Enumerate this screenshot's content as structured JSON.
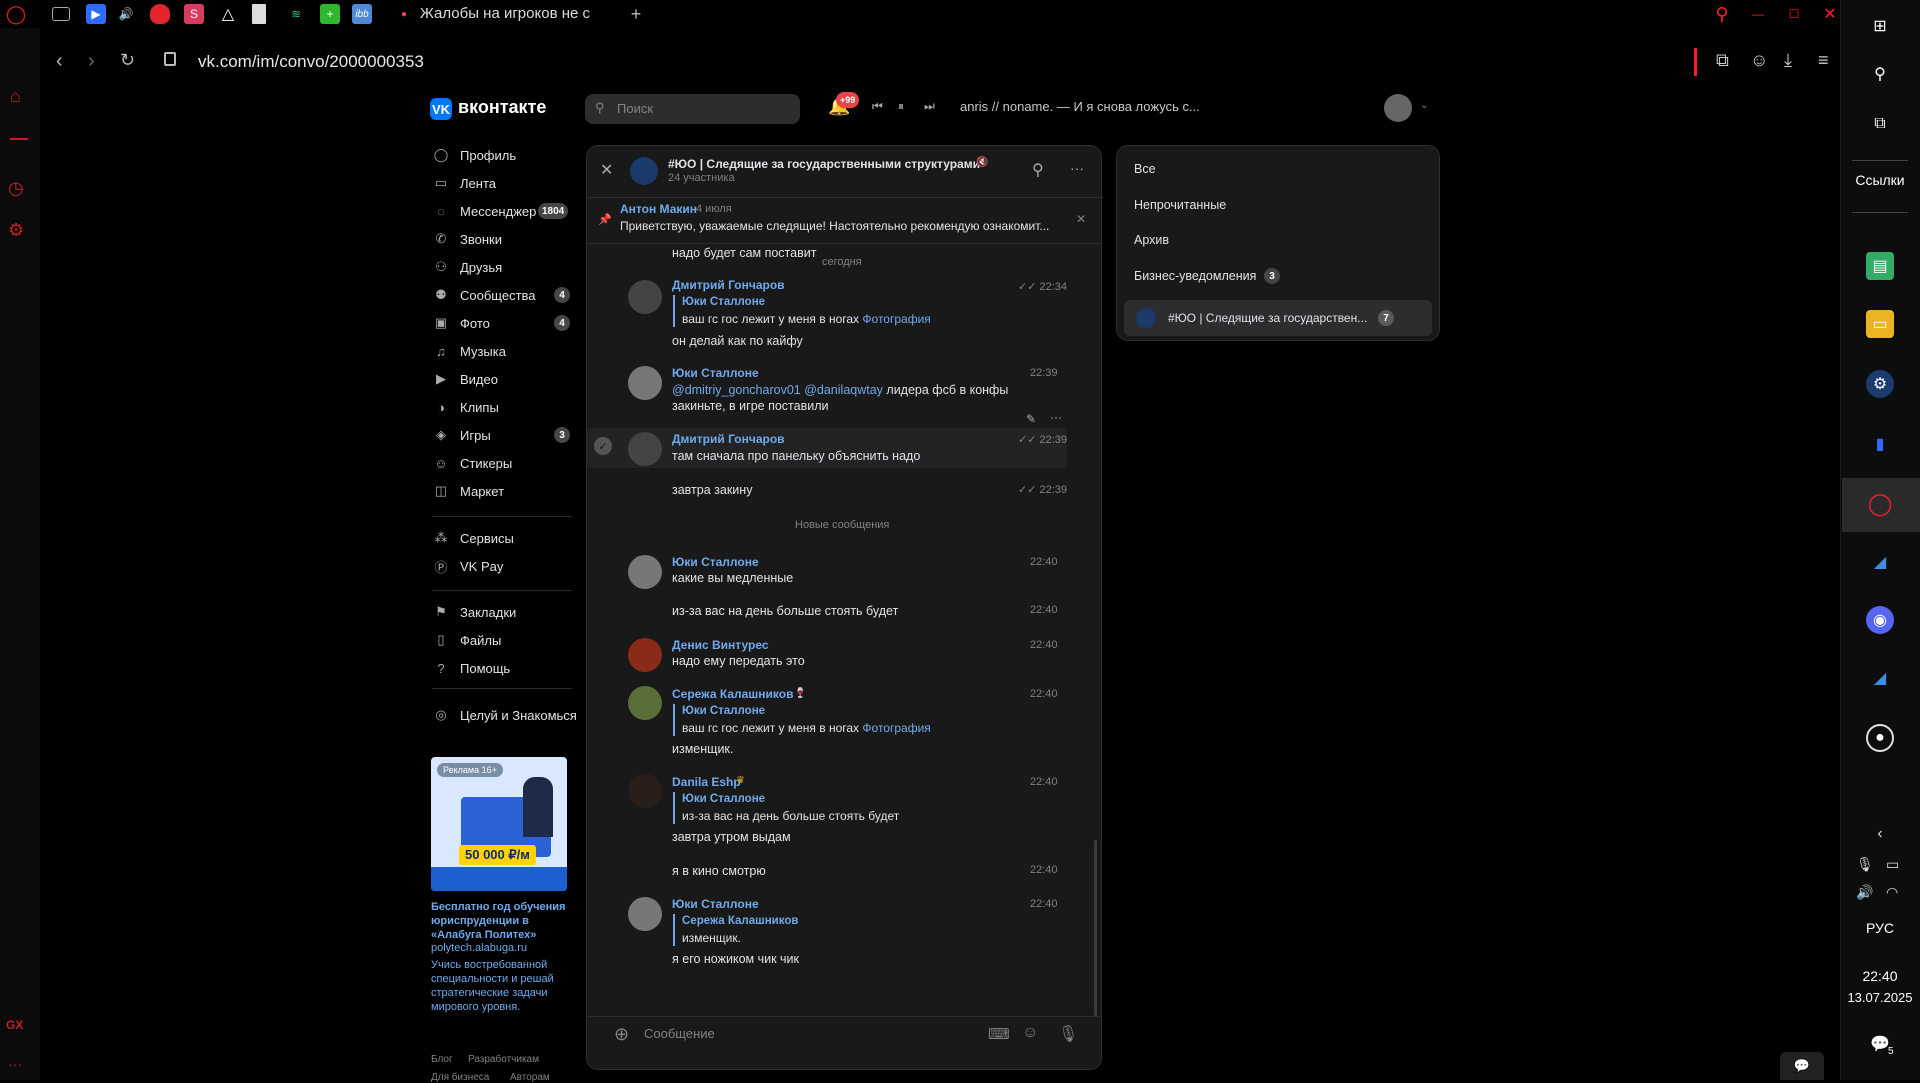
{
  "browser": {
    "tab_title": "Жалобы на игроков не с",
    "url": "vk.com/im/convo/2000000353"
  },
  "vk": {
    "logo": "вконтакте",
    "search_placeholder": "Поиск",
    "notif_badge": "+99",
    "player_track": "anris // noname. — И я снова ложусь с..."
  },
  "nav": {
    "items": [
      {
        "label": "Профиль",
        "icon": "user-icon"
      },
      {
        "label": "Лента",
        "icon": "feed-icon"
      },
      {
        "label": "Мессенджер",
        "icon": "chat-icon",
        "badge": "1804"
      },
      {
        "label": "Звонки",
        "icon": "phone-icon"
      },
      {
        "label": "Друзья",
        "icon": "friends-icon"
      },
      {
        "label": "Сообщества",
        "icon": "groups-icon",
        "badge": "4"
      },
      {
        "label": "Фото",
        "icon": "photo-icon",
        "badge": "4"
      },
      {
        "label": "Музыка",
        "icon": "music-icon"
      },
      {
        "label": "Видео",
        "icon": "video-icon"
      },
      {
        "label": "Клипы",
        "icon": "clips-icon"
      },
      {
        "label": "Игры",
        "icon": "games-icon",
        "badge": "3"
      },
      {
        "label": "Стикеры",
        "icon": "stickers-icon"
      },
      {
        "label": "Маркет",
        "icon": "market-icon"
      }
    ],
    "items2": [
      {
        "label": "Сервисы",
        "icon": "services-icon"
      },
      {
        "label": "VK Pay",
        "icon": "vkpay-icon"
      }
    ],
    "items3": [
      {
        "label": "Закладки",
        "icon": "bookmark-icon"
      },
      {
        "label": "Файлы",
        "icon": "file-icon"
      },
      {
        "label": "Помощь",
        "icon": "help-icon"
      }
    ],
    "items4": [
      {
        "label": "Целуй и Знакомься",
        "icon": "app-icon"
      }
    ]
  },
  "ad": {
    "badge": "Реклама 16+",
    "price": "50 000 ₽/м",
    "title": "Бесплатно год обучения юриспруденции в «Алабуга Политех»",
    "domain": "polytech.alabuga.ru",
    "desc": "Учись востребованной специальности и решай стратегические задачи мирового уровня."
  },
  "footer_links": [
    "Блог",
    "Разработчикам",
    "Для бизнеса",
    "Авторам"
  ],
  "chat": {
    "title": "#ЮО | Следящие за государственными структурами",
    "subtitle": "24 участника",
    "pinned_author": "Антон Макин",
    "pinned_date": "4 июля",
    "pinned_text": "Приветствую, уважаемые следящие! Настоятельно рекомендую ознакомит...",
    "prev_fragment": "надо будет сам поставит",
    "date_sep": "сегодня",
    "new_sep": "Новые сообщения",
    "input_placeholder": "Сообщение",
    "messages": [
      {
        "author": "Дмитрий Гончаров",
        "time": "22:34",
        "quote_author": "Юки Сталлоне",
        "quote_text": "ваш гс гос лежит у меня в ногах",
        "quote_link": "Фотография",
        "text": "он делай как по кайфу"
      },
      {
        "author": "Юки Сталлоне",
        "time": "22:39",
        "mention1": "@dmitriy_goncharov01",
        "mention2": "@danilaqwtay",
        "text1": " лидера фсб в конфы",
        "text2": "закиньте, в игре поставили"
      },
      {
        "author": "Дмитрий Гончаров",
        "time": "22:39",
        "text": "там сначала про панельку объяснить надо"
      },
      {
        "time": "22:39",
        "text": "завтра закину"
      },
      {
        "author": "Юки Сталлоне",
        "time": "22:40",
        "text": "какие вы медленные"
      },
      {
        "time": "22:40",
        "text": "из-за вас на день больше стоять будет"
      },
      {
        "author": "Денис Винтурес",
        "time": "22:40",
        "text": "надо ему передать это"
      },
      {
        "author": "Сережа Калашников",
        "time": "22:40",
        "quote_author": "Юки Сталлоне",
        "quote_text": "ваш гс гос лежит у меня в ногах",
        "quote_link": "Фотография",
        "text": "изменщик."
      },
      {
        "author": "Danila Eshp",
        "time": "22:40",
        "quote_author": "Юки Сталлоне",
        "quote_text": "из-за вас на день больше стоять будет",
        "text": "завтра утром выдам"
      },
      {
        "time": "22:40",
        "text": "я в кино смотрю"
      },
      {
        "author": "Юки Сталлоне",
        "time": "22:40",
        "quote_author": "Сережа Калашников",
        "quote_text": "изменщик.",
        "text": "я его ножиком чик чик"
      }
    ]
  },
  "filters": {
    "items": [
      "Все",
      "Непрочитанные",
      "Архив",
      "Бизнес-уведомления"
    ],
    "business_badge": "3",
    "convo_label": "#ЮО | Следящие за государствен...",
    "convo_badge": "7"
  },
  "taskbar": {
    "links": "Ссылки",
    "lang": "РУС",
    "time": "22:40",
    "date": "13.07.2025",
    "notif_count": "5"
  },
  "colors": {
    "accent": "#71aaeb",
    "vk_blue": "#0077ff",
    "opera_red": "#ff1b2d"
  }
}
